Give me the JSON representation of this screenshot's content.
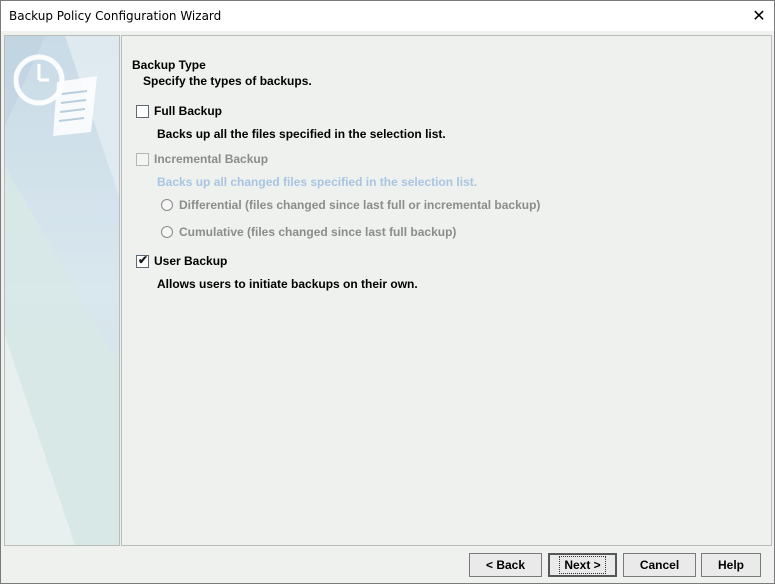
{
  "window": {
    "title": "Backup Policy Configuration Wizard",
    "close_glyph": "✕"
  },
  "content": {
    "heading": "Backup Type",
    "subheading": "Specify the types of backups.",
    "full_backup": {
      "label": "Full Backup",
      "checked": false,
      "enabled": true,
      "description": "Backs up all the files specified in the selection list."
    },
    "incremental_backup": {
      "label": "Incremental Backup",
      "checked": false,
      "enabled": false,
      "description": "Backs up all changed files specified in the selection list.",
      "options": [
        {
          "label": "Differential (files changed since last full or incremental backup)",
          "selected": false
        },
        {
          "label": "Cumulative (files changed since last full backup)",
          "selected": false
        }
      ]
    },
    "user_backup": {
      "label": "User Backup",
      "checked": true,
      "enabled": true,
      "description": "Allows users to initiate backups on their own."
    }
  },
  "buttons": {
    "back": "< Back",
    "next": "Next >",
    "cancel": "Cancel",
    "help": "Help"
  },
  "icons": {
    "side_graphic": "clock-scroll-icon",
    "checkmark": "✔"
  },
  "colors": {
    "panel_bg": "#eef1ee",
    "disabled_desc": "#a9c5e3",
    "disabled_text": "#8c8c8c"
  }
}
